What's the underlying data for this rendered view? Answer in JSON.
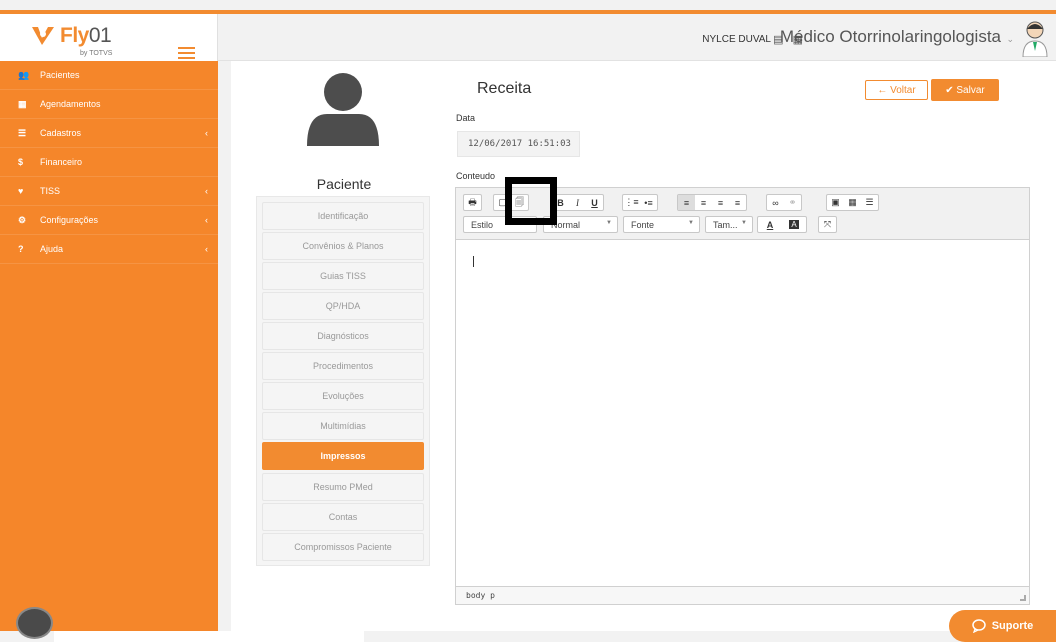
{
  "brand": {
    "name": "Fly",
    "zero": "01",
    "sub": "by TOTVS"
  },
  "header": {
    "user": "NYLCE DUVAL",
    "icons": "▤ ▦",
    "role": "Médico Otorrinolaringologista",
    "chevron": "⌄"
  },
  "sidebar": {
    "items": [
      {
        "icon": "👥",
        "label": "Pacientes"
      },
      {
        "icon": "▦",
        "label": "Agendamentos"
      },
      {
        "icon": "☰",
        "label": "Cadastros",
        "caret": "‹"
      },
      {
        "icon": "$",
        "label": "Financeiro"
      },
      {
        "icon": "♥",
        "label": "TISS",
        "caret": "‹"
      },
      {
        "icon": "⚙",
        "label": "Configurações",
        "caret": "‹"
      },
      {
        "icon": "?",
        "label": "Ajuda",
        "caret": "‹"
      }
    ]
  },
  "patient": {
    "title": "Paciente",
    "menu": [
      "Identificação",
      "Convênios & Planos",
      "Guias TISS",
      "QP/HDA",
      "Diagnósticos",
      "Procedimentos",
      "Evoluções",
      "Multimídias",
      "Impressos",
      "Resumo PMed",
      "Contas",
      "Compromissos Paciente"
    ],
    "active": "Impressos"
  },
  "form": {
    "title": "Receita",
    "back_label": "← Voltar",
    "save_label": "✔ Salvar",
    "date_label": "Data",
    "date_value": "12/06/2017 16:51:03",
    "content_label": "Conteudo"
  },
  "editor": {
    "toolbar_row1": [
      "🖶",
      "▢",
      "🗐",
      "B",
      "I",
      "U",
      "⋮≡",
      "•≡",
      "≡",
      "≡",
      "≡",
      "≡",
      "∞",
      "⚭",
      "▣",
      "▦",
      "☰"
    ],
    "styles_label": "Estilo",
    "format_label": "Normal",
    "font_label": "Fonte",
    "size_label": "Tam...",
    "text_color": "A",
    "bg_color": "A",
    "maximize": "⤧",
    "status_path": "body  p"
  },
  "support": {
    "label": "Suporte"
  },
  "colors": {
    "accent": "#f28b30",
    "sidebar": "#f5862a"
  }
}
